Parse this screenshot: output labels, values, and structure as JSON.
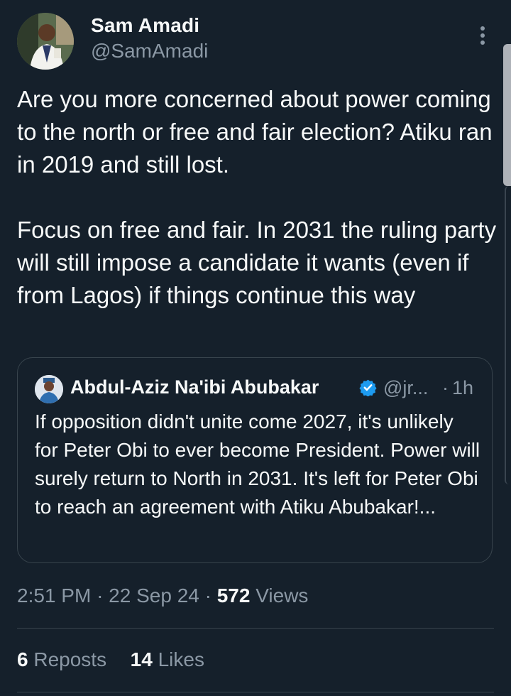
{
  "author": {
    "display_name": "Sam Amadi",
    "handle": "@SamAmadi"
  },
  "tweet": {
    "text": "Are you more concerned about power coming to the north or free and fair election? Atiku ran in 2019 and still lost.\n\nFocus on free and fair. In 2031 the ruling party will still impose a candidate it wants (even if from Lagos) if things continue this way"
  },
  "quoted_tweet": {
    "display_name": "Abdul-Aziz Na'ibi Abubakar",
    "handle": "@jr...",
    "separator": "·",
    "time": "1h",
    "text": "If opposition didn't unite come 2027, it's unlikely for Peter Obi to ever become President. Power will surely return to North in 2031. It's left for Peter Obi to reach an agreement with Atiku Abubakar!..."
  },
  "meta": {
    "time": "2:51 PM",
    "separator": "·",
    "date": "22 Sep 24",
    "views_count": "572",
    "views_label": "Views"
  },
  "stats": {
    "reposts_count": "6",
    "reposts_label": "Reposts",
    "likes_count": "14",
    "likes_label": "Likes"
  },
  "icons": {
    "more": "more-vertical-icon",
    "verified": "verified-badge-icon"
  },
  "colors": {
    "background": "#15202b",
    "text": "#f7f9f9",
    "secondary_text": "#8b98a5",
    "border": "#38444d",
    "verified": "#1d9bf0"
  }
}
